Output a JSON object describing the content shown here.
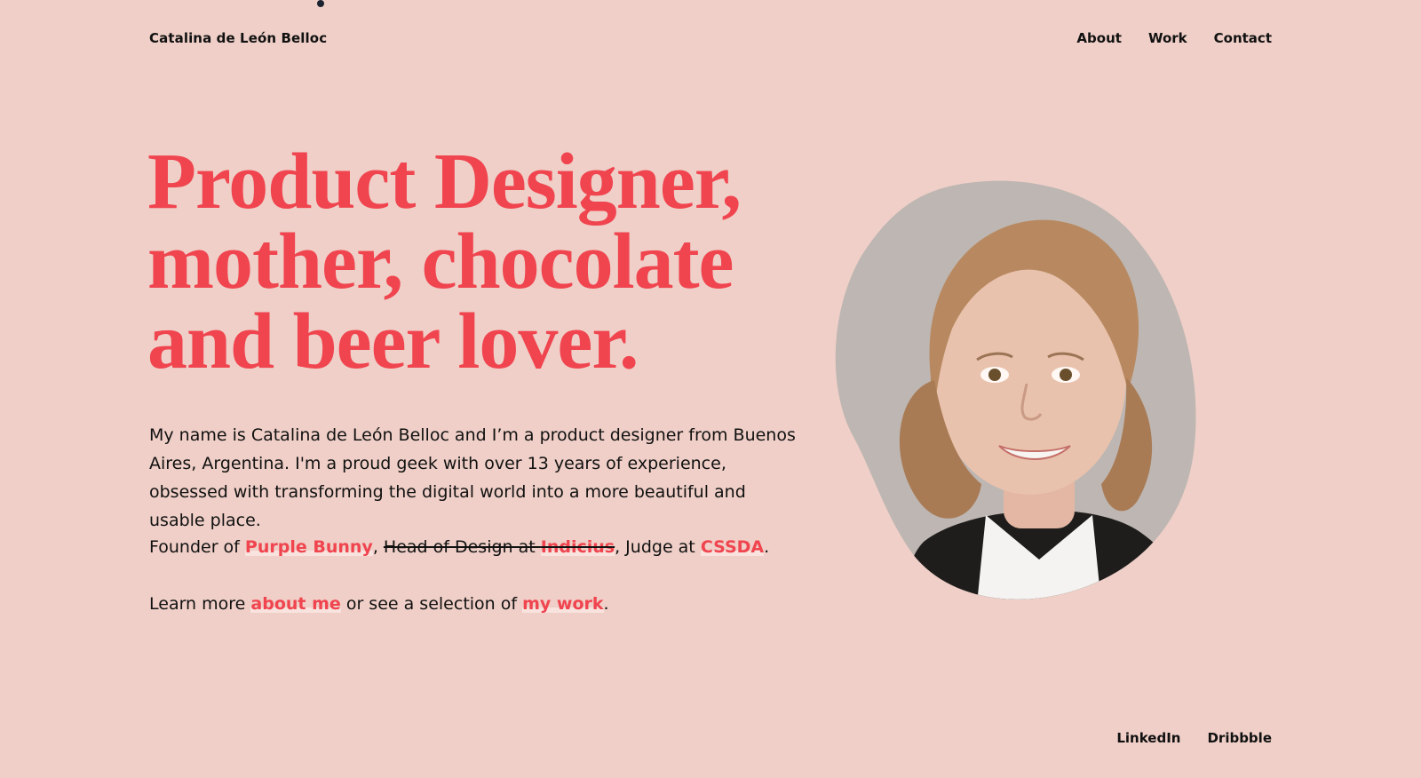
{
  "header": {
    "site_name": "Catalina de León Belloc",
    "nav": [
      {
        "label": "About"
      },
      {
        "label": "Work"
      },
      {
        "label": "Contact"
      }
    ]
  },
  "hero": {
    "headline_lines": [
      "Product Designer,",
      "mother, chocolate",
      "and beer lover."
    ],
    "intro": "My name is Catalina de León Belloc and I’m a product designer from Buenos Aires, Argentina. I'm a proud geek with over 13 years of experience, obsessed with transforming the digital world into a more beautiful and usable place.",
    "roles": {
      "founder_prefix": "Founder of ",
      "founder_link": "Purple Bunny",
      "separator_1": ", ",
      "former_role_text": "Head of Design at ",
      "former_role_link": "Indicius",
      "separator_2": ", Judge at ",
      "judge_link": "CSSDA",
      "end": "."
    },
    "learn_more": {
      "prefix": "Learn more ",
      "about_link": "about me",
      "middle": " or see a selection of ",
      "work_link": "my work",
      "end": "."
    }
  },
  "portrait": {
    "subject": "portrait-photo"
  },
  "footer": {
    "social": [
      {
        "label": "LinkedIn"
      },
      {
        "label": "Dribbble"
      }
    ]
  },
  "colors": {
    "background": "#efcfc7",
    "accent": "#f0444f",
    "text": "#111111"
  }
}
